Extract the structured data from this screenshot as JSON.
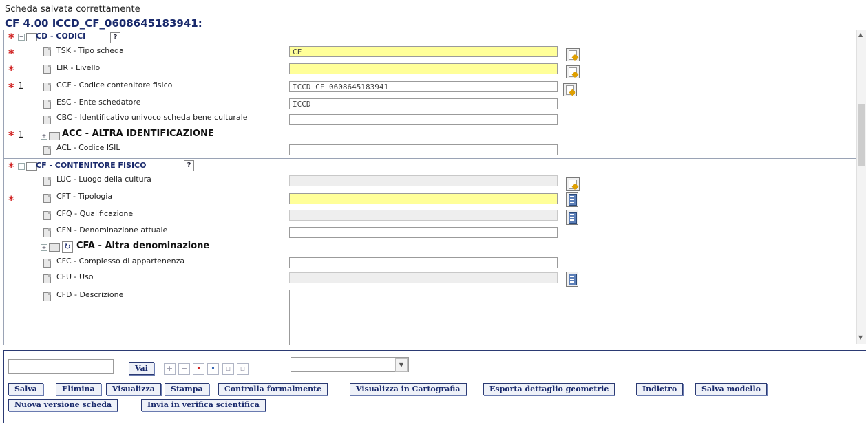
{
  "status_message": "Scheda salvata correttamente",
  "record_title": "CF 4.00 ICCD_CF_0608645183941:",
  "sections": {
    "cd": {
      "label": "CD - CODICI",
      "help": "?"
    },
    "cf": {
      "label": "CF - CONTENITORE FISICO",
      "help": "?"
    }
  },
  "fields": {
    "tsk": {
      "label": "TSK - Tipo scheda",
      "value": "CF"
    },
    "lir": {
      "label": "LIR - Livello",
      "value": ""
    },
    "ccf": {
      "label": "CCF - Codice contenitore fisico",
      "value": "ICCD_CF_0608645183941",
      "count": "1"
    },
    "esc": {
      "label": "ESC - Ente schedatore",
      "value": "ICCD"
    },
    "cbc": {
      "label": "CBC - Identificativo univoco scheda bene culturale",
      "value": ""
    },
    "acc": {
      "label": "ACC - ALTRA IDENTIFICAZIONE",
      "count": "1"
    },
    "acl": {
      "label": "ACL - Codice ISIL",
      "value": ""
    },
    "luc": {
      "label": "LUC - Luogo della cultura",
      "value": ""
    },
    "cft": {
      "label": "CFT - Tipologia",
      "value": ""
    },
    "cfq": {
      "label": "CFQ - Qualificazione",
      "value": ""
    },
    "cfn": {
      "label": "CFN - Denominazione attuale",
      "value": ""
    },
    "cfa": {
      "label": "CFA - Altra denominazione"
    },
    "cfc": {
      "label": "CFC - Complesso di appartenenza",
      "value": ""
    },
    "cfu": {
      "label": "CFU - Uso",
      "value": ""
    },
    "cfd": {
      "label": "CFD - Descrizione",
      "value": ""
    }
  },
  "required_marker": "*",
  "toolbar": {
    "search_value": "",
    "go_label": "Vai",
    "select_value": "",
    "buttons": {
      "save": "Salva",
      "delete": "Elimina",
      "view": "Visualizza",
      "print": "Stampa",
      "validate": "Controlla formalmente",
      "map": "Visualizza in Cartografia",
      "export_geom": "Esporta dettaglio geometrie",
      "back": "Indietro",
      "save_model": "Salva modello",
      "new_version": "Nuova versione scheda",
      "send_review": "Invia in verifica scientifica"
    }
  },
  "colors": {
    "required_field": "#ffff99",
    "title": "#1a2a6c",
    "required_star": "#d02020"
  },
  "icons": {
    "page": "document-icon",
    "folder": "folder-icon",
    "lookup": "lookup-icon",
    "list": "list-icon"
  }
}
